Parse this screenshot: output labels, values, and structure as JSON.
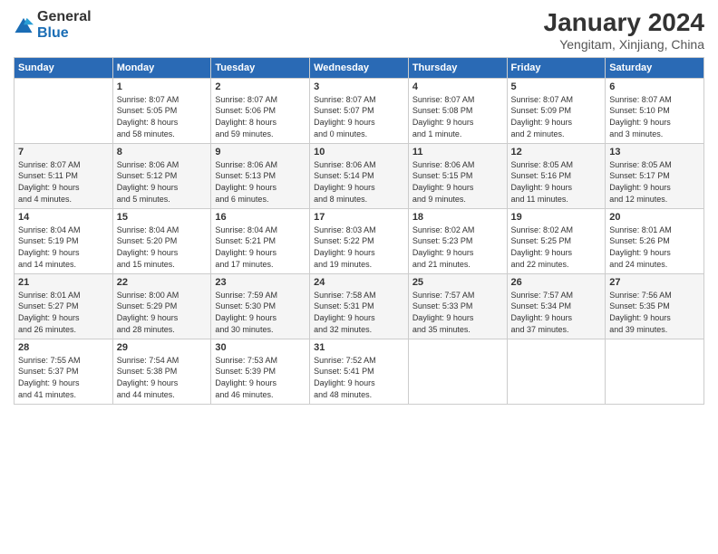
{
  "logo": {
    "general": "General",
    "blue": "Blue"
  },
  "title": "January 2024",
  "subtitle": "Yengitam, Xinjiang, China",
  "headers": [
    "Sunday",
    "Monday",
    "Tuesday",
    "Wednesday",
    "Thursday",
    "Friday",
    "Saturday"
  ],
  "weeks": [
    [
      {
        "day": "",
        "info": ""
      },
      {
        "day": "1",
        "info": "Sunrise: 8:07 AM\nSunset: 5:05 PM\nDaylight: 8 hours\nand 58 minutes."
      },
      {
        "day": "2",
        "info": "Sunrise: 8:07 AM\nSunset: 5:06 PM\nDaylight: 8 hours\nand 59 minutes."
      },
      {
        "day": "3",
        "info": "Sunrise: 8:07 AM\nSunset: 5:07 PM\nDaylight: 9 hours\nand 0 minutes."
      },
      {
        "day": "4",
        "info": "Sunrise: 8:07 AM\nSunset: 5:08 PM\nDaylight: 9 hours\nand 1 minute."
      },
      {
        "day": "5",
        "info": "Sunrise: 8:07 AM\nSunset: 5:09 PM\nDaylight: 9 hours\nand 2 minutes."
      },
      {
        "day": "6",
        "info": "Sunrise: 8:07 AM\nSunset: 5:10 PM\nDaylight: 9 hours\nand 3 minutes."
      }
    ],
    [
      {
        "day": "7",
        "info": "Sunrise: 8:07 AM\nSunset: 5:11 PM\nDaylight: 9 hours\nand 4 minutes."
      },
      {
        "day": "8",
        "info": "Sunrise: 8:06 AM\nSunset: 5:12 PM\nDaylight: 9 hours\nand 5 minutes."
      },
      {
        "day": "9",
        "info": "Sunrise: 8:06 AM\nSunset: 5:13 PM\nDaylight: 9 hours\nand 6 minutes."
      },
      {
        "day": "10",
        "info": "Sunrise: 8:06 AM\nSunset: 5:14 PM\nDaylight: 9 hours\nand 8 minutes."
      },
      {
        "day": "11",
        "info": "Sunrise: 8:06 AM\nSunset: 5:15 PM\nDaylight: 9 hours\nand 9 minutes."
      },
      {
        "day": "12",
        "info": "Sunrise: 8:05 AM\nSunset: 5:16 PM\nDaylight: 9 hours\nand 11 minutes."
      },
      {
        "day": "13",
        "info": "Sunrise: 8:05 AM\nSunset: 5:17 PM\nDaylight: 9 hours\nand 12 minutes."
      }
    ],
    [
      {
        "day": "14",
        "info": "Sunrise: 8:04 AM\nSunset: 5:19 PM\nDaylight: 9 hours\nand 14 minutes."
      },
      {
        "day": "15",
        "info": "Sunrise: 8:04 AM\nSunset: 5:20 PM\nDaylight: 9 hours\nand 15 minutes."
      },
      {
        "day": "16",
        "info": "Sunrise: 8:04 AM\nSunset: 5:21 PM\nDaylight: 9 hours\nand 17 minutes."
      },
      {
        "day": "17",
        "info": "Sunrise: 8:03 AM\nSunset: 5:22 PM\nDaylight: 9 hours\nand 19 minutes."
      },
      {
        "day": "18",
        "info": "Sunrise: 8:02 AM\nSunset: 5:23 PM\nDaylight: 9 hours\nand 21 minutes."
      },
      {
        "day": "19",
        "info": "Sunrise: 8:02 AM\nSunset: 5:25 PM\nDaylight: 9 hours\nand 22 minutes."
      },
      {
        "day": "20",
        "info": "Sunrise: 8:01 AM\nSunset: 5:26 PM\nDaylight: 9 hours\nand 24 minutes."
      }
    ],
    [
      {
        "day": "21",
        "info": "Sunrise: 8:01 AM\nSunset: 5:27 PM\nDaylight: 9 hours\nand 26 minutes."
      },
      {
        "day": "22",
        "info": "Sunrise: 8:00 AM\nSunset: 5:29 PM\nDaylight: 9 hours\nand 28 minutes."
      },
      {
        "day": "23",
        "info": "Sunrise: 7:59 AM\nSunset: 5:30 PM\nDaylight: 9 hours\nand 30 minutes."
      },
      {
        "day": "24",
        "info": "Sunrise: 7:58 AM\nSunset: 5:31 PM\nDaylight: 9 hours\nand 32 minutes."
      },
      {
        "day": "25",
        "info": "Sunrise: 7:57 AM\nSunset: 5:33 PM\nDaylight: 9 hours\nand 35 minutes."
      },
      {
        "day": "26",
        "info": "Sunrise: 7:57 AM\nSunset: 5:34 PM\nDaylight: 9 hours\nand 37 minutes."
      },
      {
        "day": "27",
        "info": "Sunrise: 7:56 AM\nSunset: 5:35 PM\nDaylight: 9 hours\nand 39 minutes."
      }
    ],
    [
      {
        "day": "28",
        "info": "Sunrise: 7:55 AM\nSunset: 5:37 PM\nDaylight: 9 hours\nand 41 minutes."
      },
      {
        "day": "29",
        "info": "Sunrise: 7:54 AM\nSunset: 5:38 PM\nDaylight: 9 hours\nand 44 minutes."
      },
      {
        "day": "30",
        "info": "Sunrise: 7:53 AM\nSunset: 5:39 PM\nDaylight: 9 hours\nand 46 minutes."
      },
      {
        "day": "31",
        "info": "Sunrise: 7:52 AM\nSunset: 5:41 PM\nDaylight: 9 hours\nand 48 minutes."
      },
      {
        "day": "",
        "info": ""
      },
      {
        "day": "",
        "info": ""
      },
      {
        "day": "",
        "info": ""
      }
    ]
  ]
}
